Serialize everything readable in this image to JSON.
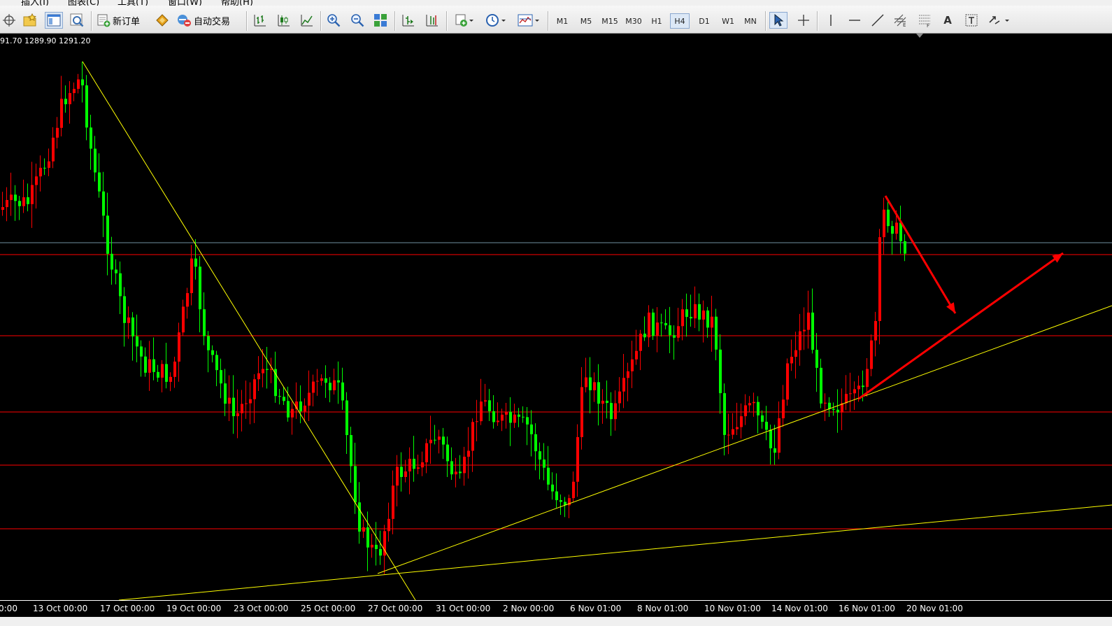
{
  "menu": [
    "插入(I)",
    "图表(C)",
    "工具(T)",
    "窗口(W)",
    "帮助(H)"
  ],
  "toolbar": {
    "new_order_label": "新订单",
    "auto_trade_label": "自动交易",
    "timeframes": [
      "M1",
      "M5",
      "M15",
      "M30",
      "H1",
      "H4",
      "D1",
      "W1",
      "MN"
    ],
    "active_timeframe": "H4",
    "text_tool_label": "A"
  },
  "chart": {
    "ohlc_text": "91.70 1289.90 1291.20",
    "x_labels": [
      "0:00",
      "13 Oct 00:00",
      "17 Oct 00:00",
      "19 Oct 00:00",
      "23 Oct 00:00",
      "25 Oct 00:00",
      "27 Oct 00:00",
      "31 Oct 00:00",
      "2 Nov 00:00",
      "6 Nov 01:00",
      "8 Nov 01:00",
      "10 Nov 01:00",
      "14 Nov 01:00",
      "16 Nov 01:00",
      "20 Nov 01:00"
    ],
    "colors": {
      "background": "#000000",
      "bull": "#ff0000",
      "bear": "#00ff00",
      "horizontal_line": "#ff0000",
      "bid_line": "#6f8f9f",
      "trendline": "#ffff00",
      "arrow": "#ff0000"
    }
  }
}
